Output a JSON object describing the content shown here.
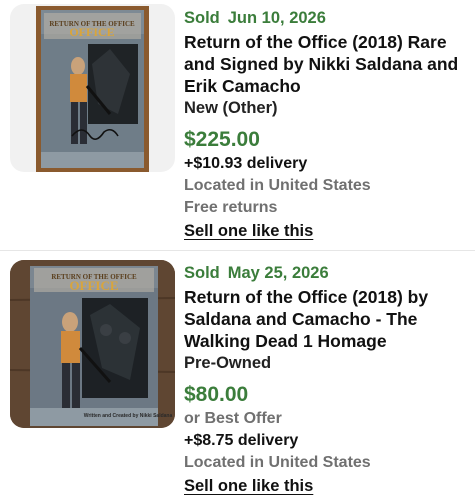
{
  "listings": [
    {
      "sold_label": "Sold",
      "sold_date": "Jun 10, 2026",
      "title": "Return of the Office (2018) Rare and Signed by Nikki Saldana and Erik Camacho",
      "condition": "New (Other)",
      "price": "$225.00",
      "delivery": "+$10.93 delivery",
      "location": "Located in United States",
      "returns": "Free returns",
      "sell_link": "Sell one like this",
      "cover_logo": "RETURN OF THE OFFICE"
    },
    {
      "sold_label": "Sold",
      "sold_date": "May 25, 2026",
      "title": "Return of the Office (2018) by Saldana and Camacho - The Walking Dead 1 Homage",
      "condition": "Pre-Owned",
      "price": "$80.00",
      "best_offer": "or Best Offer",
      "delivery": "+$8.75 delivery",
      "location": "Located in United States",
      "sell_link": "Sell one like this",
      "cover_logo": "RETURN OF THE OFFICE",
      "cover_credit": "Written and Created by Nikki Saldana"
    }
  ],
  "colors": {
    "sold_green": "#3b7d3b",
    "grey_text": "#707070"
  }
}
